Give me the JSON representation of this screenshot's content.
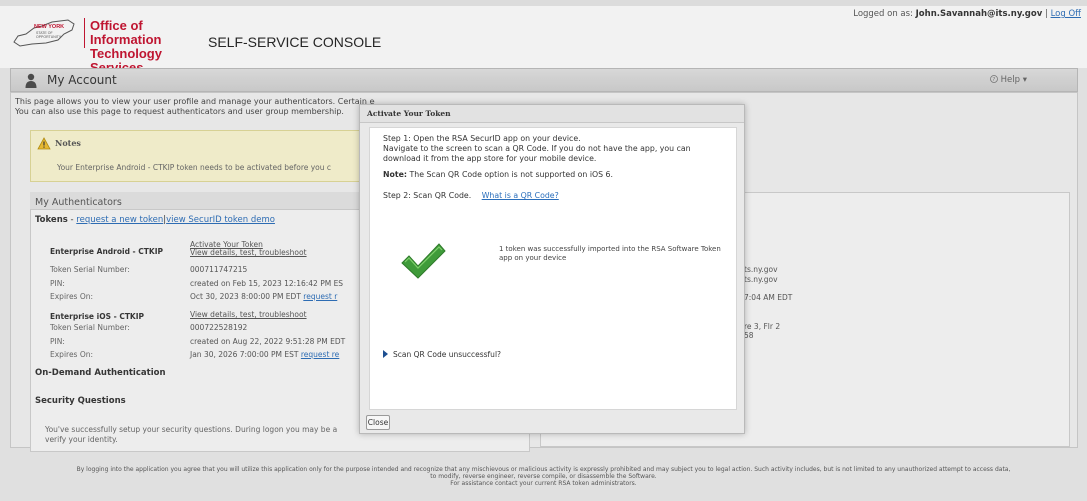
{
  "header": {
    "org_name": "Office of Information Technology Services",
    "console_title": "SELF-SERVICE CONSOLE",
    "logged_on_label": "Logged on as:",
    "user_email": "John.Savannah@its.ny.gov",
    "separator": "|",
    "logoff": "Log Off"
  },
  "account_bar": {
    "title": "My Account",
    "help": "Help ▾"
  },
  "intro": {
    "line1": "This page allows you to view your user profile and manage your authenticators. Certain edits to your account require administrator approval.",
    "line2": "You can also use this page to request authenticators and user group membership."
  },
  "notes": {
    "title": "Notes",
    "text": "Your Enterprise Android - CTKIP token needs to be activated before you c"
  },
  "authenticators": {
    "title": "My Authenticators",
    "tokens_label": "Tokens",
    "tokens_dash": "-",
    "request_link": "request a new token",
    "pipe": "|",
    "demo_link": "view SecurID token demo",
    "tokens": [
      {
        "name": "Enterprise Android - CTKIP",
        "activate_link": "Activate Your Token",
        "actions": "View details, test, troubleshoot",
        "serial_label": "Token Serial Number:",
        "serial": "000711747215",
        "pin_label": "PIN:",
        "pin": "created on Feb 15, 2023 12:16:42 PM ES",
        "expires_label": "Expires On:",
        "expires": "Oct 30, 2023 8:00:00 PM EDT",
        "request_link": "request r"
      },
      {
        "name": "Enterprise iOS - CTKIP",
        "actions": "View details, test, troubleshoot",
        "serial_label": "Token Serial Number:",
        "serial": "000722528192",
        "pin_label": "PIN:",
        "pin": "created on Aug 22, 2022 9:51:28 PM EDT",
        "expires_label": "Expires On:",
        "expires": "Jan 30, 2026 7:00:00 PM EST",
        "request_link": "request re"
      }
    ],
    "on_demand": "On-Demand Authentication",
    "security_questions": "Security Questions",
    "sq_text": "You've successfully setup your security questions. During logon you may be a verify your identity."
  },
  "right_panel": {
    "line1": "ts.ny.gov",
    "line2": "ts.ny.gov",
    "line3": "7:04 AM EDT",
    "line4": "re 3, Flr 2",
    "line5": "58"
  },
  "footer": {
    "line1": "By logging into the application you agree that you will utilize this application only for the purpose intended and recognize that any mischievous or malicious activity is expressly prohibited and may subject you to legal action. Such activity includes, but is not limited to any unauthorized attempt to access data,",
    "line2": "to modify, reverse engineer, reverse compile, or disassemble the Software.",
    "line3": "For assistance contact your current RSA token administrators."
  },
  "modal": {
    "title": "Activate Your Token",
    "step1_line1": "Step 1: Open the RSA SecurID app on your device.",
    "step1_line2": "Navigate to the screen to scan a QR Code. If you do not have the app, you can download it from the app store for your mobile device.",
    "note_label": "Note:",
    "note_text": "The Scan QR Code option is not supported on iOS 6.",
    "step2": "Step 2: Scan QR Code.",
    "qr_link": "What is a QR Code?",
    "success_msg": "1 token was successfully imported into the RSA Software Token app on your device",
    "unsuccess": "Scan QR Code unsuccessful?",
    "close": "Close"
  },
  "colors": {
    "brand_red": "#c8102e",
    "link_blue": "#2a6ebb",
    "check_green": "#3f9b3a",
    "notes_bg": "#fcf8d3"
  }
}
